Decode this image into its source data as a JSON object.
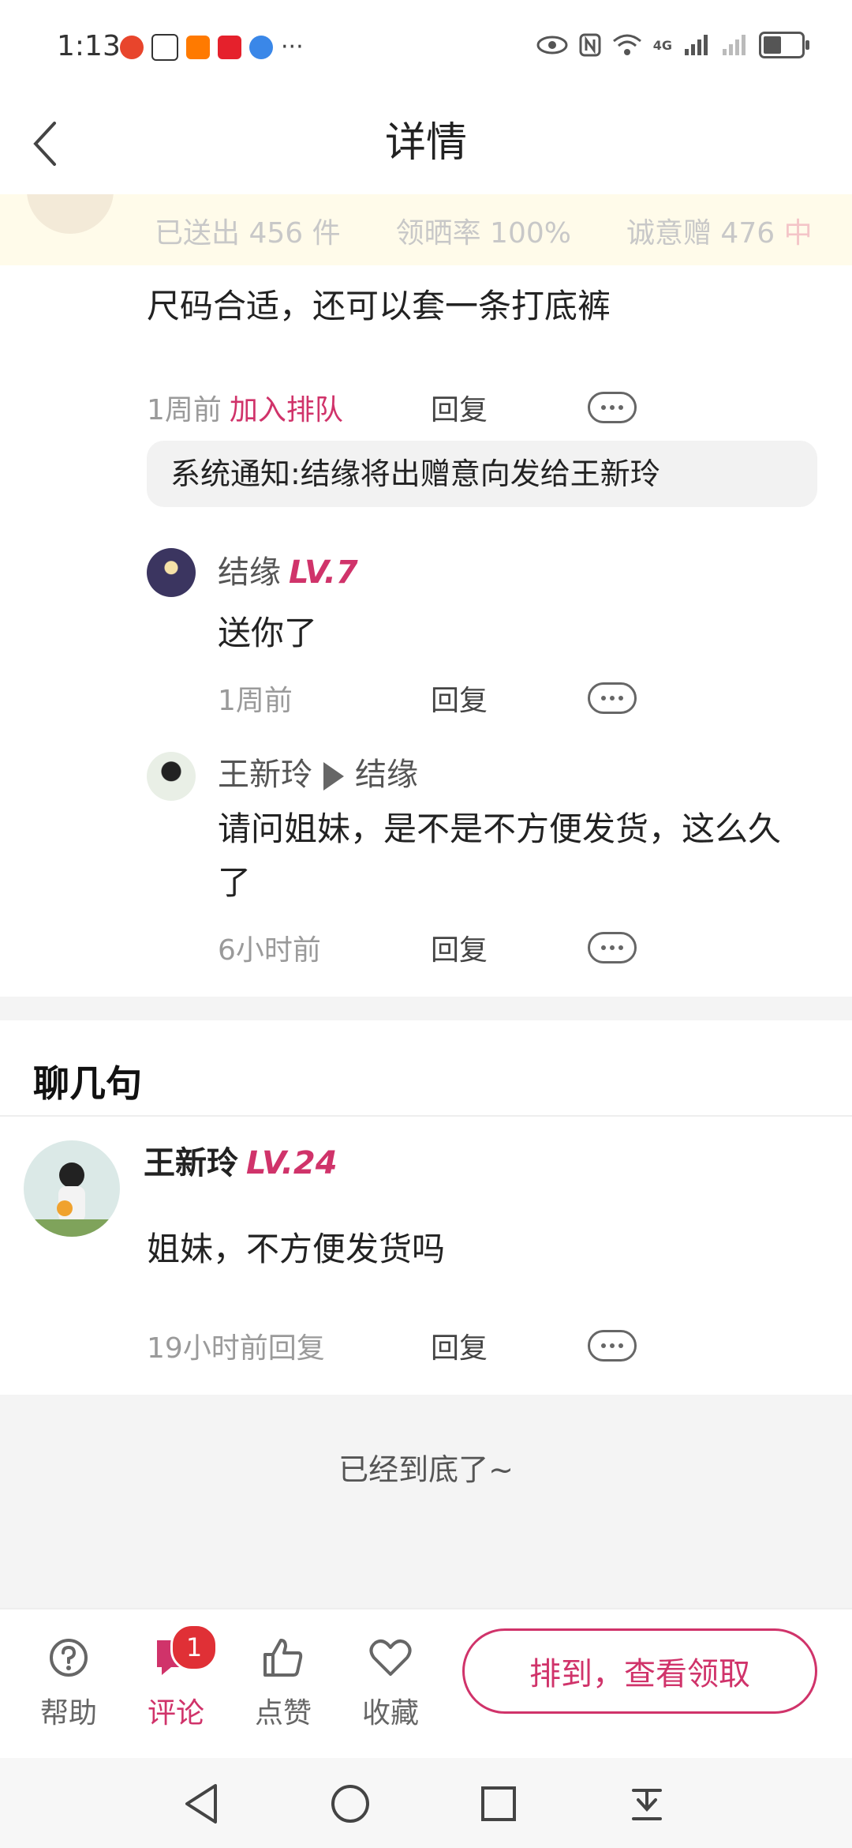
{
  "status_bar": {
    "time": "1:13",
    "ellipsis": "···",
    "network": "4G"
  },
  "nav": {
    "title": "详情"
  },
  "stats": {
    "sent": "已送出 456 件",
    "rate": "领晒率 100%",
    "gift_prefix": "诚意赠 476",
    "gift_level": "中"
  },
  "post": {
    "text": "尺码合适，还可以套一条打底裤",
    "time": "1周前",
    "join_label": "加入排队",
    "reply_label": "回复"
  },
  "notice": {
    "text": "系统通知:结缘将出赠意向发给王新玲"
  },
  "replies": [
    {
      "name": "结缘",
      "level": "LV.7",
      "text": "送你了",
      "time": "1周前",
      "reply_label": "回复"
    },
    {
      "name": "王新玲",
      "to": "结缘",
      "text": "请问姐妹，是不是不方便发货，这么久了",
      "time": "6小时前",
      "reply_label": "回复"
    }
  ],
  "chat_section": {
    "title": "聊几句",
    "comment": {
      "name": "王新玲",
      "level": "LV.24",
      "text": "姐妹，不方便发货吗",
      "time": "19小时前回复",
      "reply_label": "回复"
    }
  },
  "end_text": "已经到底了~",
  "bottom_bar": {
    "help": "帮助",
    "comment": "评论",
    "comment_badge": "1",
    "like": "点赞",
    "favorite": "收藏",
    "claim_button": "排到，查看领取"
  },
  "colors": {
    "accent": "#d0336a",
    "badge": "#e03036",
    "banner": "#fffbea"
  }
}
